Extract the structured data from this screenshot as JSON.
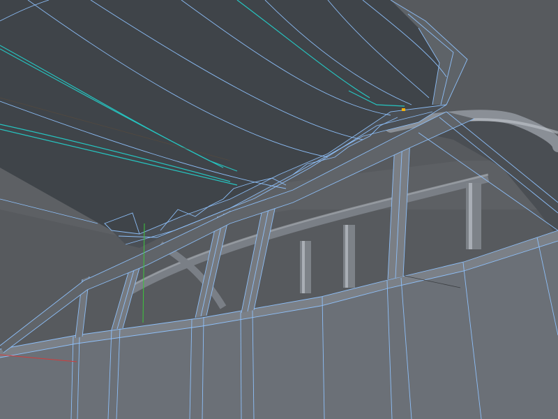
{
  "viewport": {
    "kind": "3d-modeling-viewport",
    "display_mode": "shaded-wireframe",
    "colors": {
      "background": "#575a5e",
      "roof_surface": "#3e4348",
      "roof_shade": "#33373c",
      "wall_surface": "#6e737a",
      "strut_surface": "#707379",
      "wireframe": "#8fc3ff",
      "selected_edges": "#26c4c0",
      "selected_vertex": "#f2b20c",
      "axis_x": "#d23c3c",
      "axis_y": "#3cc83c"
    },
    "icons": {
      "axis_x": "axis-x-line",
      "axis_y": "axis-y-line",
      "vertex": "selected-vertex-point"
    }
  }
}
